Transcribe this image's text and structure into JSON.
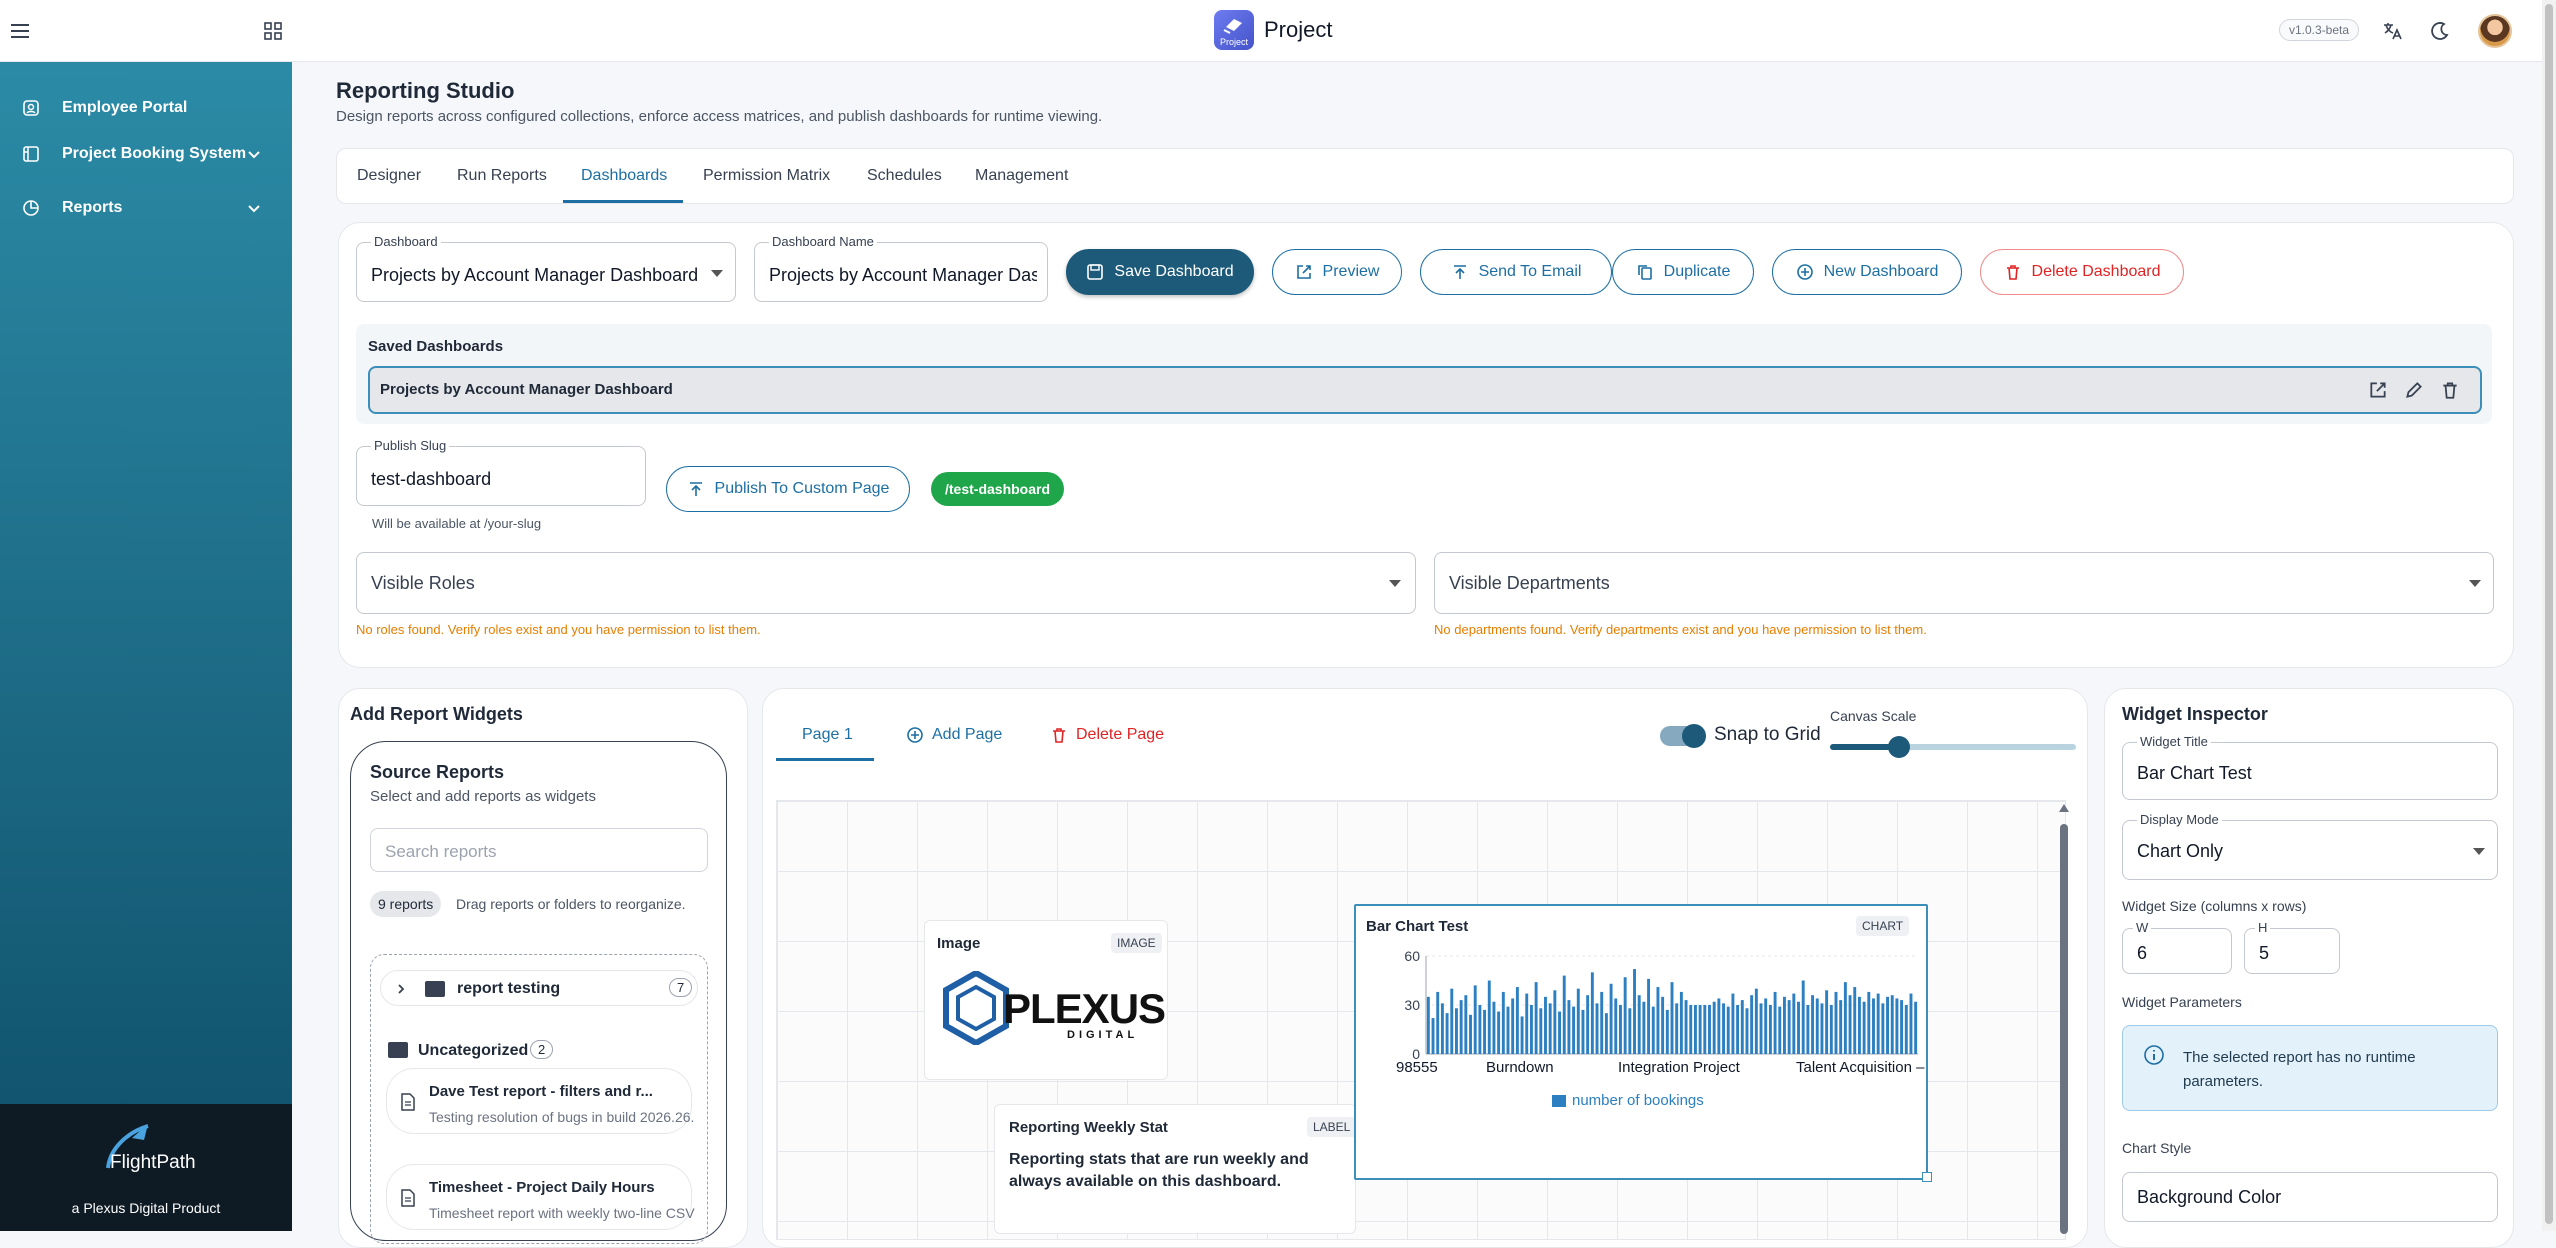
{
  "topbar": {
    "title": "Project",
    "logo_text": "Project",
    "version": "v1.0.3-beta"
  },
  "sidebar": {
    "items": [
      {
        "label": "Employee Portal"
      },
      {
        "label": "Project Booking System"
      },
      {
        "label": "Reports"
      }
    ],
    "footer_brand": "FlightPath",
    "footer_sub": "a Plexus Digital Product"
  },
  "page": {
    "title": "Reporting Studio",
    "subtitle": "Design reports across configured collections, enforce access matrices, and publish dashboards for runtime viewing."
  },
  "tabs": [
    "Designer",
    "Run Reports",
    "Dashboards",
    "Permission Matrix",
    "Schedules",
    "Management"
  ],
  "dashboard": {
    "select_label": "Dashboard",
    "select_value": "Projects by Account Manager Dashboard",
    "name_label": "Dashboard Name",
    "name_value": "Projects by Account Manager Dashboard",
    "buttons": {
      "save": "Save Dashboard",
      "preview": "Preview",
      "email": "Send To Email",
      "duplicate": "Duplicate",
      "new": "New Dashboard",
      "delete": "Delete Dashboard"
    },
    "saved_title": "Saved Dashboards",
    "saved_items": [
      "Projects by Account Manager Dashboard"
    ],
    "slug_label": "Publish Slug",
    "slug_value": "test-dashboard",
    "slug_hint": "Will be available at /your-slug",
    "publish_button": "Publish To Custom Page",
    "slug_pill": "/test-dashboard",
    "roles_label": "Visible Roles",
    "roles_warning": "No roles found. Verify roles exist and you have permission to list them.",
    "depts_label": "Visible Departments",
    "depts_warning": "No departments found. Verify departments exist and you have permission to list them."
  },
  "widgets_panel": {
    "title": "Add Report Widgets",
    "source_title": "Source Reports",
    "source_sub": "Select and add reports as widgets",
    "search_placeholder": "Search reports",
    "count": "9 reports",
    "count_hint": "Drag reports or folders to reorganize.",
    "folders": [
      {
        "name": "report testing",
        "count": "7"
      },
      {
        "name": "Uncategorized",
        "count": "2"
      }
    ],
    "reports": [
      {
        "title": "Dave Test report - filters and r...",
        "desc": "Testing resolution of bugs in build 2026.26."
      },
      {
        "title": "Timesheet - Project Daily Hours",
        "desc": "Timesheet report with weekly two-line CSV"
      }
    ]
  },
  "canvas": {
    "page_tab": "Page 1",
    "add_page": "Add Page",
    "delete_page": "Delete Page",
    "snap_label": "Snap to Grid",
    "snap_on": true,
    "scale_label": "Canvas Scale",
    "scale_value": 0.28,
    "image_widget": {
      "title": "Image",
      "tag": "IMAGE",
      "logo_main": "PLEXUS",
      "logo_sub": "DIGITAL"
    },
    "label_widget": {
      "title": "Reporting Weekly Stat",
      "tag": "LABEL",
      "text": "Reporting stats that are run weekly and always available on this dashboard."
    },
    "chart_widget": {
      "title": "Bar Chart Test",
      "tag": "CHART"
    }
  },
  "chart_data": {
    "type": "bar",
    "title": "Bar Chart Test",
    "xlabel": "",
    "ylabel": "",
    "ylim": [
      0,
      60
    ],
    "yticks": [
      0,
      30,
      60
    ],
    "tick_labels": [
      "98555",
      "Burndown",
      "Integration Project",
      "Talent Acquisition – Refresh"
    ],
    "grid": true,
    "legend": "bottom",
    "series": [
      {
        "name": "number of bookings",
        "color": "#2c7fc0",
        "values": [
          35,
          22,
          38,
          31,
          25,
          40,
          28,
          33,
          36,
          24,
          42,
          30,
          27,
          45,
          32,
          26,
          38,
          29,
          34,
          41,
          23,
          37,
          30,
          44,
          28,
          35,
          31,
          39,
          26,
          48,
          33,
          29,
          40,
          27,
          36,
          50,
          31,
          38,
          25,
          43,
          34,
          30,
          47,
          28,
          52,
          36,
          32,
          46,
          29,
          41,
          35,
          27,
          44,
          31,
          38,
          33,
          30,
          30,
          30,
          30,
          30,
          32,
          34,
          31,
          29,
          37,
          30,
          33,
          28,
          36,
          40,
          31,
          34,
          30,
          38,
          29,
          35,
          33,
          37,
          32,
          45,
          30,
          36,
          34,
          31,
          39,
          30,
          38,
          33,
          44,
          36,
          41,
          35,
          32,
          38,
          34,
          37,
          31,
          35,
          36,
          34,
          33,
          30,
          37,
          32
        ]
      }
    ]
  },
  "inspector": {
    "title": "Widget Inspector",
    "widget_title_label": "Widget Title",
    "widget_title_value": "Bar Chart Test",
    "display_mode_label": "Display Mode",
    "display_mode_value": "Chart Only",
    "size_label": "Widget Size (columns x rows)",
    "w_label": "W",
    "w_value": "6",
    "h_label": "H",
    "h_value": "5",
    "params_label": "Widget Parameters",
    "params_info": "The selected report has no runtime parameters.",
    "chart_style_label": "Chart Style",
    "bg_color_label": "Background Color"
  }
}
